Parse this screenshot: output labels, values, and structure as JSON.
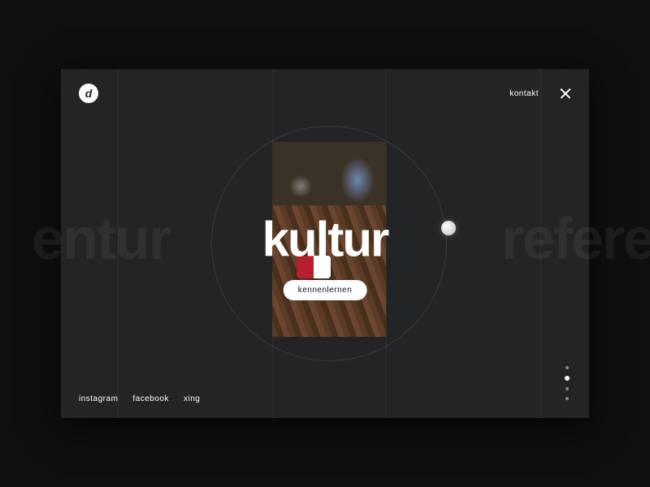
{
  "header": {
    "logo_letter": "d",
    "kontakt": "kontakt"
  },
  "hero": {
    "nav_prev": "entur",
    "nav_next": "refere",
    "title": "kultur",
    "cta": "kennenlernen"
  },
  "socials": {
    "instagram": "instagram",
    "facebook": "facebook",
    "xing": "xing"
  },
  "progress": {
    "count": 4,
    "active_index": 1
  },
  "colors": {
    "background": "#0f0f0f",
    "panel": "#232425",
    "text": "#ffffff"
  }
}
